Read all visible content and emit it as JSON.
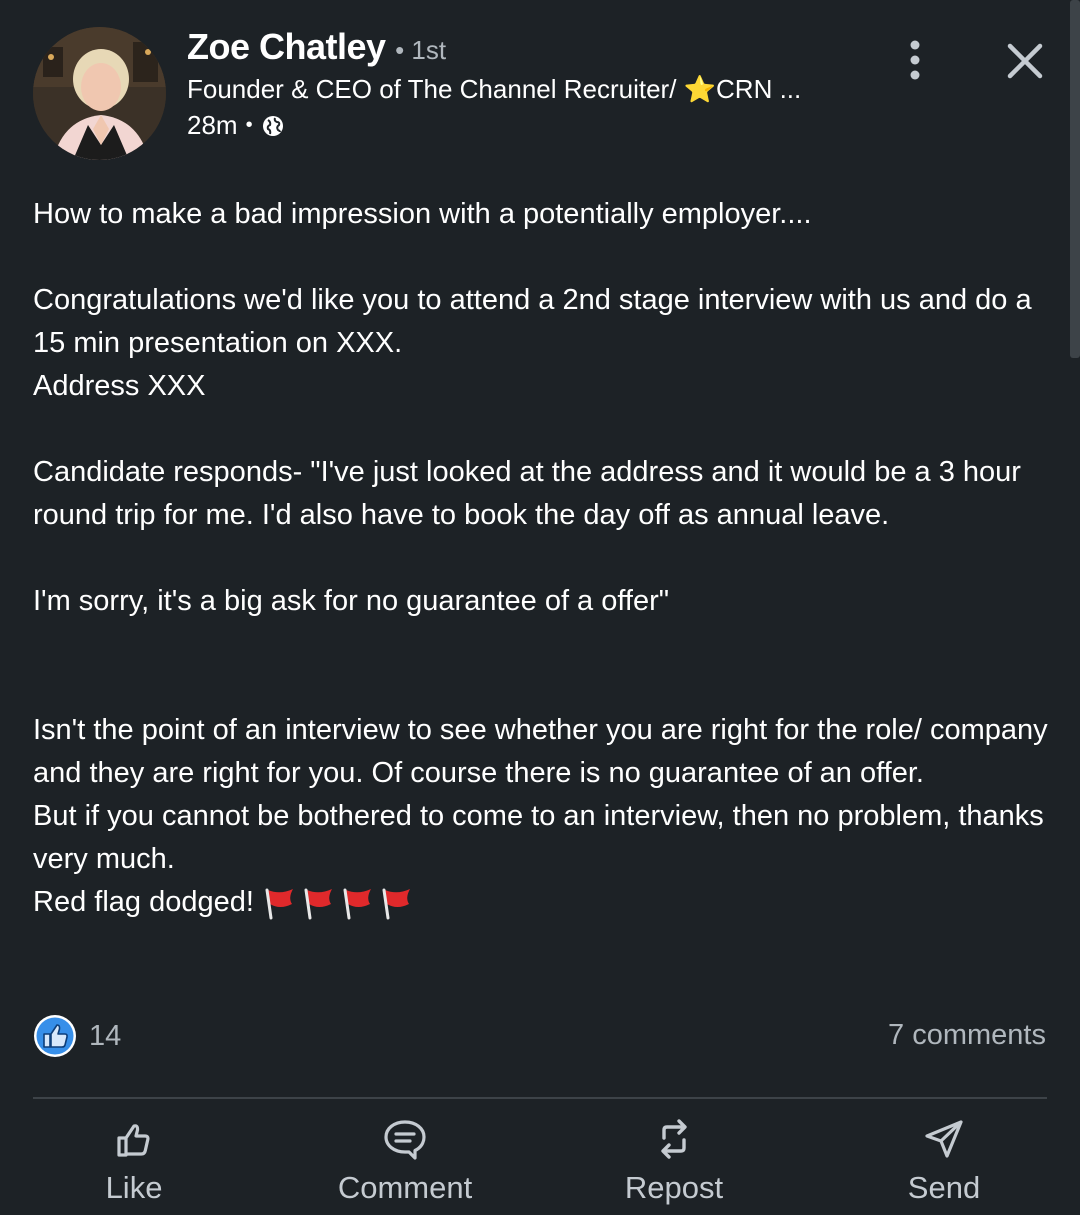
{
  "author": {
    "name": "Zoe Chatley",
    "degree": "• 1st",
    "headline": "Founder & CEO of The Channel Recruiter/ ⭐CRN ...",
    "time": "28m",
    "separator": "•",
    "visibility_icon": "globe-icon"
  },
  "post": {
    "paragraphs": [
      "How to make a bad impression with a potentially employer....",
      "",
      "Congratulations we'd like you to attend a 2nd stage interview with us and do a 15 min presentation on XXX.",
      "Address XXX",
      "",
      "Candidate responds- \"I've just looked at the address and it would be a 3 hour round trip for me. I'd also have to book the day off as annual leave.",
      "",
      "I'm sorry, it's a big ask for no guarantee of a offer\"",
      "",
      "",
      "Isn't the point of an interview to see whether you are right for the role/ company and they are right for you. Of course there is no guarantee of an offer.",
      "But if you cannot be bothered to come to an interview, then no problem, thanks very much."
    ],
    "last_line": "Red flag dodged!",
    "flag_count": 4
  },
  "social": {
    "reaction_count": "14",
    "comments": "7 comments"
  },
  "actions": {
    "like": "Like",
    "comment": "Comment",
    "repost": "Repost",
    "send": "Send"
  },
  "colors": {
    "background": "#1d2226",
    "text": "#ffffff",
    "muted": "#b0b7bd",
    "like_blue": "#378fe9",
    "flag_red": "#e0292b"
  }
}
